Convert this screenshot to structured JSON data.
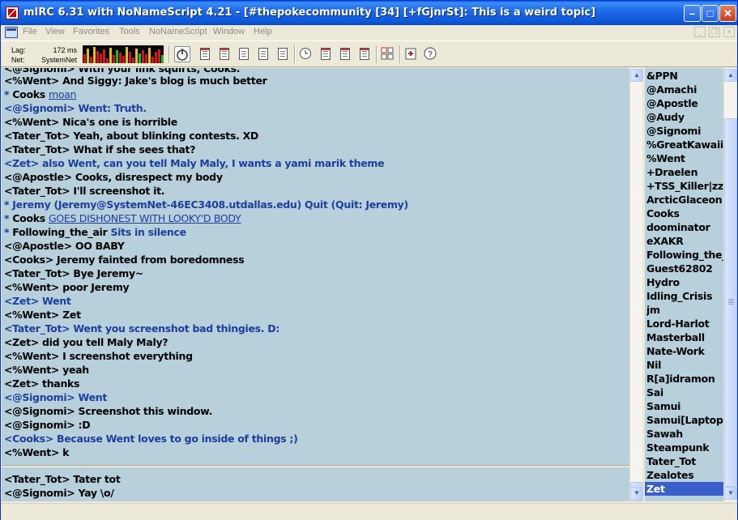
{
  "window": {
    "title": "mIRC 6.31 with NoNameScript 4.21 - [#thepokecommunity [34] [+fGjnrSt]: This is a weird topic]",
    "min_glyph": "–",
    "max_glyph": "□",
    "close_glyph": "✕"
  },
  "menu": [
    "File",
    "View",
    "Favorites",
    "Tools",
    "NoNameScript",
    "Window",
    "Help"
  ],
  "toolbar": {
    "lag_label": "Lag:",
    "net_label": "Net:",
    "lag_value": "172 ms",
    "net_value": "SystemNet",
    "lag_history": [
      0.55,
      0.9,
      0.4,
      1.0,
      0.75,
      0.6,
      0.85,
      0.3,
      0.95,
      0.5,
      0.8,
      0.65,
      0.45,
      1.0,
      0.7,
      0.35,
      0.9,
      0.6,
      0.8,
      0.55,
      0.95,
      0.4,
      0.7,
      0.85,
      0.5
    ]
  },
  "chat": {
    "partial_top": "<@Signomi> With your link squirts, Cooks.",
    "lines": [
      {
        "parts": [
          {
            "t": "<%Went> ",
            "c": "nick"
          },
          {
            "t": "And Siggy: Jake's blog is much better",
            "c": "msg"
          }
        ]
      },
      {
        "parts": [
          {
            "t": "* ",
            "c": "act"
          },
          {
            "t": "Cooks ",
            "c": "act-nick"
          },
          {
            "t": "moan",
            "c": "link"
          }
        ]
      },
      {
        "parts": [
          {
            "t": "<@Signomi> ",
            "c": "hl"
          },
          {
            "t": "Went: Truth.",
            "c": "hl"
          }
        ]
      },
      {
        "parts": [
          {
            "t": "<%Went> ",
            "c": "nick"
          },
          {
            "t": "Nica's one is horrible",
            "c": "msg"
          }
        ]
      },
      {
        "parts": [
          {
            "t": "<Tater_Tot> ",
            "c": "nick"
          },
          {
            "t": "Yeah, about blinking contests. XD",
            "c": "msg"
          }
        ]
      },
      {
        "parts": [
          {
            "t": "<Tater_Tot> ",
            "c": "nick"
          },
          {
            "t": "What if she sees that?",
            "c": "msg"
          }
        ]
      },
      {
        "parts": [
          {
            "t": "<Zet> ",
            "c": "hl"
          },
          {
            "t": "also Went, can you tell Maly Maly, I wants a yami marik theme",
            "c": "hl"
          }
        ]
      },
      {
        "parts": [
          {
            "t": "<@Apostle> ",
            "c": "nick"
          },
          {
            "t": "Cooks, disrespect my body",
            "c": "msg"
          }
        ]
      },
      {
        "parts": [
          {
            "t": "<Tater_Tot> ",
            "c": "nick"
          },
          {
            "t": "I'll screenshot it.",
            "c": "msg"
          }
        ]
      },
      {
        "parts": [
          {
            "t": "* Jeremy (Jeremy@SystemNet-46EC3408.utdallas.edu) Quit (Quit: Jeremy)",
            "c": "act"
          }
        ]
      },
      {
        "parts": [
          {
            "t": "* ",
            "c": "act"
          },
          {
            "t": "Cooks ",
            "c": "act-nick"
          },
          {
            "t": "GOES DISHONEST WITH LOOKY'D BODY",
            "c": "link"
          }
        ]
      },
      {
        "parts": [
          {
            "t": "* ",
            "c": "act"
          },
          {
            "t": "Following_the_air ",
            "c": "act-nick"
          },
          {
            "t": "Sits in silence",
            "c": "act"
          }
        ]
      },
      {
        "parts": [
          {
            "t": "<@Apostle> ",
            "c": "nick"
          },
          {
            "t": "OO BABY",
            "c": "msg"
          }
        ]
      },
      {
        "parts": [
          {
            "t": "<Cooks> ",
            "c": "nick"
          },
          {
            "t": "Jeremy fainted from boredomness",
            "c": "msg"
          }
        ]
      },
      {
        "parts": [
          {
            "t": "<Tater_Tot> ",
            "c": "nick"
          },
          {
            "t": "Bye Jeremy~",
            "c": "msg"
          }
        ]
      },
      {
        "parts": [
          {
            "t": "<%Went> ",
            "c": "nick"
          },
          {
            "t": "poor Jeremy",
            "c": "msg"
          }
        ]
      },
      {
        "parts": [
          {
            "t": "<Zet> ",
            "c": "hl"
          },
          {
            "t": "Went",
            "c": "hl"
          }
        ]
      },
      {
        "parts": [
          {
            "t": "<%Went> ",
            "c": "nick"
          },
          {
            "t": "Zet",
            "c": "msg"
          }
        ]
      },
      {
        "parts": [
          {
            "t": "<Tater_Tot> ",
            "c": "hl"
          },
          {
            "t": "Went you screenshot bad thingies. D:",
            "c": "hl"
          }
        ]
      },
      {
        "parts": [
          {
            "t": "<Zet> ",
            "c": "nick"
          },
          {
            "t": "did you tell Maly Maly?",
            "c": "msg"
          }
        ]
      },
      {
        "parts": [
          {
            "t": "<%Went> ",
            "c": "nick"
          },
          {
            "t": "I screenshot everything",
            "c": "msg"
          }
        ]
      },
      {
        "parts": [
          {
            "t": "<%Went> ",
            "c": "nick"
          },
          {
            "t": "yeah",
            "c": "msg"
          }
        ]
      },
      {
        "parts": [
          {
            "t": "<Zet> ",
            "c": "nick"
          },
          {
            "t": "thanks",
            "c": "msg"
          }
        ]
      },
      {
        "parts": [
          {
            "t": "<@Signomi> ",
            "c": "hl"
          },
          {
            "t": "Went",
            "c": "hl"
          }
        ]
      },
      {
        "parts": [
          {
            "t": "<@Signomi> ",
            "c": "nick"
          },
          {
            "t": "Screenshot this window.",
            "c": "msg"
          }
        ]
      },
      {
        "parts": [
          {
            "t": "<@Signomi> ",
            "c": "nick"
          },
          {
            "t": ":D",
            "c": "msg"
          }
        ]
      },
      {
        "parts": [
          {
            "t": "<Cooks> ",
            "c": "hl"
          },
          {
            "t": "Because Went loves to go inside of things ;)",
            "c": "hl"
          }
        ]
      },
      {
        "parts": [
          {
            "t": "<%Went> ",
            "c": "nick"
          },
          {
            "t": "k",
            "c": "msg"
          }
        ]
      }
    ]
  },
  "editbox": {
    "lines": [
      {
        "parts": [
          {
            "t": "<Tater_Tot> ",
            "c": "nick"
          },
          {
            "t": "Tater tot",
            "c": "msg"
          }
        ]
      },
      {
        "parts": [
          {
            "t": "<@Signomi> ",
            "c": "nick"
          },
          {
            "t": "Yay \\o/",
            "c": "msg"
          }
        ]
      }
    ]
  },
  "nicklist": {
    "items": [
      "&PPN",
      "@Amachi",
      "@Apostle",
      "@Audy",
      "@Signomi",
      "%GreatKawaiiP",
      "%Went",
      "+Draelen",
      "+TSS_Killer|zzz",
      "ArcticGlaceon",
      "Cooks",
      "doominator",
      "eXAKR",
      "Following_the_air",
      "Guest62802",
      "Hydro",
      "Idling_Crisis",
      "jm",
      "Lord-Harlot",
      "Masterball",
      "Nate-Work",
      "Nil",
      "R[a]idramon",
      "Sai",
      "Samui",
      "Samui[Laptop]",
      "Sawah",
      "Steampunk",
      "Tater_Tot",
      "Zealotes",
      "Zet"
    ],
    "selected": "Zet"
  },
  "colors": {
    "chat_bg": "#b8d0dc",
    "highlight": "#1c3e9c",
    "selection": "#3a5fcd"
  }
}
